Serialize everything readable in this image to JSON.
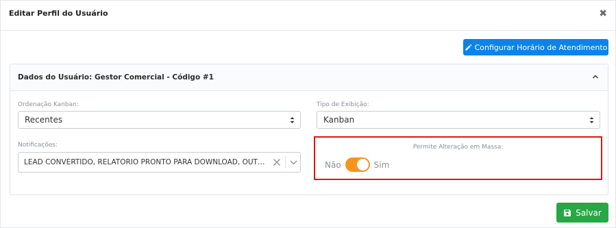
{
  "modal": {
    "title": "Editar Perfil do Usuário",
    "close_glyph": "✖"
  },
  "toolbar": {
    "config_label": "Configurar Horário de Atendimento",
    "config_icon": "pencil-icon"
  },
  "card": {
    "title": "Dados do Usuário: Gestor Comercial - Código #1",
    "collapse_icon": "chevron-up-icon"
  },
  "form": {
    "ordenacao": {
      "label": "Ordenação Kanban:",
      "value": "Recentes"
    },
    "tipo": {
      "label": "Tipo de Exibição:",
      "value": "Kanban"
    },
    "notificacoes": {
      "label": "Notificações:",
      "value": "LEAD CONVERTIDO, RELATÓRIO PRONTO PARA DOWNLOAD, OUTROS"
    },
    "massa": {
      "label": "Permite Alteração em Massa:",
      "off_label": "Não",
      "on_label": "Sim",
      "checked": true
    }
  },
  "actions": {
    "save_label": "Salvar",
    "save_icon": "floppy-disk-icon"
  },
  "colors": {
    "primary": "#0d83e8",
    "success": "#28a745",
    "toggle_on": "#f7941d",
    "highlight": "#e01414"
  }
}
